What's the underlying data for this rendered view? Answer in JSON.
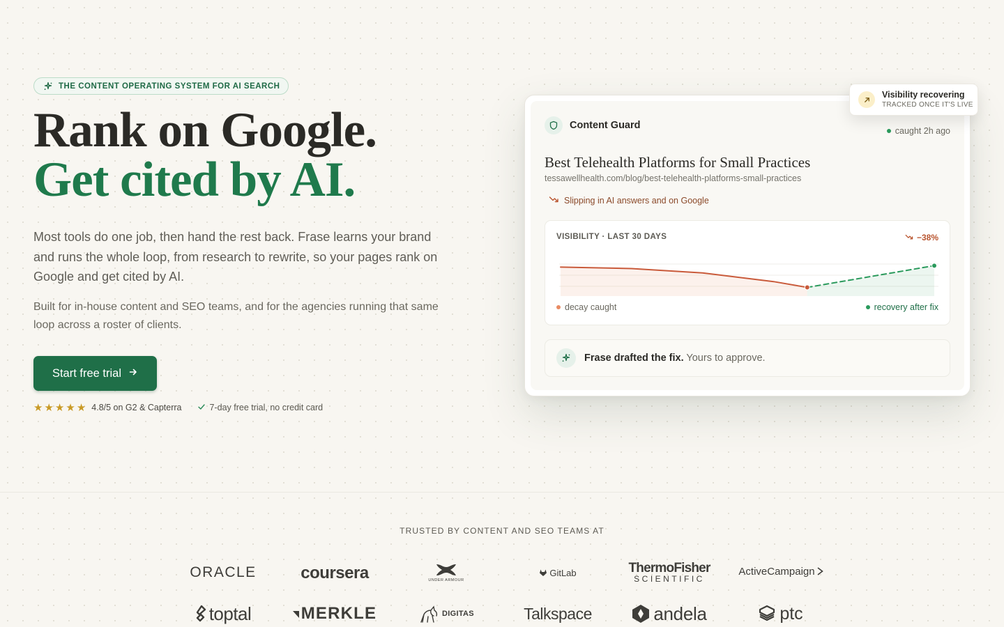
{
  "hero": {
    "eyebrow": "THE CONTENT OPERATING SYSTEM FOR AI SEARCH",
    "title_line1": "Rank on Google.",
    "title_line2": "Get cited by AI.",
    "lead": "Most tools do one job, then hand the rest back. Frase learns your brand and runs the whole loop, from research to rewrite, so your pages rank on Google and get cited by AI.",
    "sub": "Built for in-house content and SEO teams, and for the agencies running that same loop across a roster of clients.",
    "cta_label": "Start free trial",
    "rating_text": "4.8/5 on G2 & Capterra",
    "rating_stars": 5,
    "trial_text": "7-day free trial, no credit card"
  },
  "toast": {
    "title": "Visibility recovering",
    "subtitle": "TRACKED ONCE IT'S LIVE"
  },
  "card": {
    "header": "Content Guard",
    "caught": "caught 2h ago",
    "article_title": "Best Telehealth Platforms for Small Practices",
    "article_url": "tessawellhealth.com/blog/best-telehealth-platforms-small-practices",
    "status": "Slipping in AI answers and on Google",
    "visibility_label": "VISIBILITY · LAST 30 DAYS",
    "visibility_delta": "−38%",
    "legend_left": "decay caught",
    "legend_right": "recovery after fix",
    "fix_strong": "Frase drafted the fix.",
    "fix_rest": "Yours to approve."
  },
  "colors": {
    "brand_green": "#1f6f48",
    "decay": "#c95a3a",
    "recovery": "#2a9a5c",
    "star": "#c99a25"
  },
  "chart_data": {
    "type": "line",
    "series": [
      {
        "name": "decay caught",
        "x": [
          0,
          0.19,
          0.38,
          0.57,
          0.66
        ],
        "values": [
          1.0,
          0.98,
          0.92,
          0.8,
          0.72
        ]
      },
      {
        "name": "recovery after fix",
        "x": [
          0.66,
          1.0
        ],
        "values": [
          0.72,
          1.02
        ]
      }
    ],
    "ylim": [
      0.6,
      1.1
    ]
  },
  "trusted": {
    "label": "TRUSTED BY CONTENT AND SEO TEAMS AT",
    "logos": [
      "ORACLE",
      "coursera",
      "UNDER ARMOUR",
      "GitLab",
      "ThermoFisher",
      "SCIENTIFIC",
      "ActiveCampaign",
      "toptal",
      "MERKLE",
      "DIGITAS",
      "Talkspace",
      "andela",
      "ptc"
    ]
  }
}
